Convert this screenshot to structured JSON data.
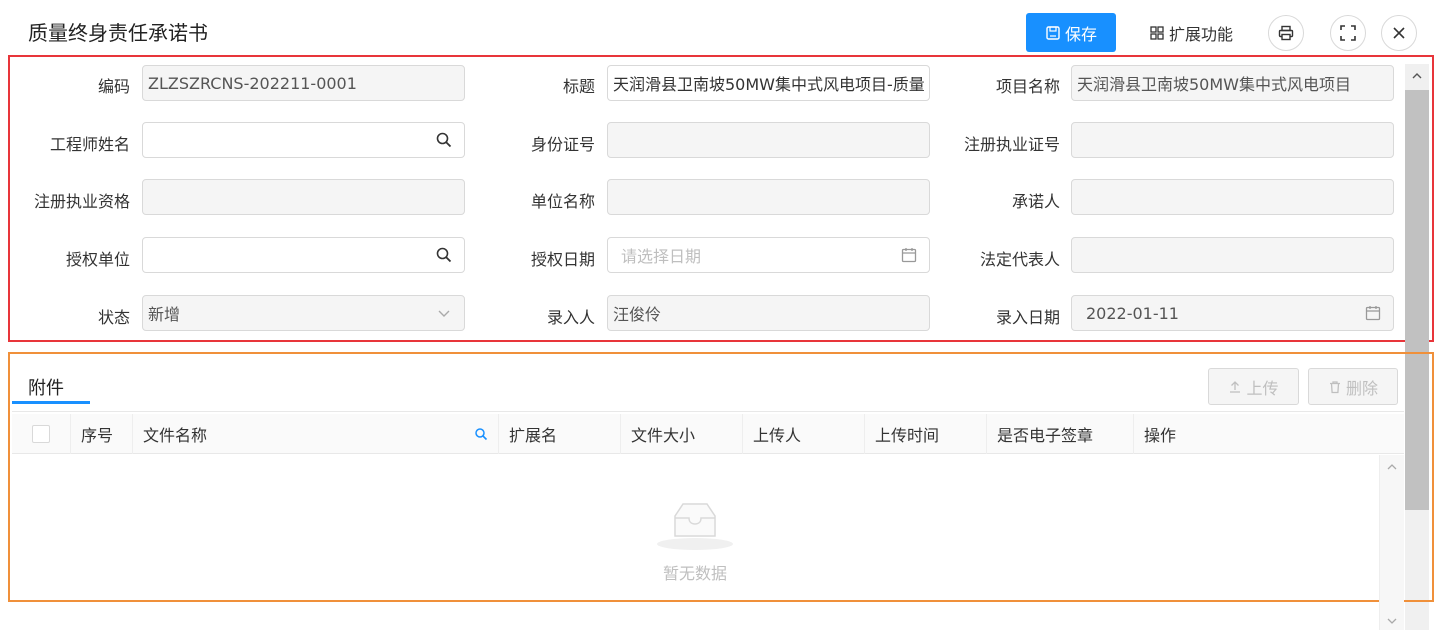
{
  "header": {
    "title": "质量终身责任承诺书",
    "save_label": "保存",
    "ext_label": "扩展功能"
  },
  "form": {
    "code_label": "编码",
    "code_value": "ZLZSZRCNS-202211-0001",
    "title_label": "标题",
    "title_value": "天润滑县卫南坡50MW集中式风电项目-质量",
    "project_label": "项目名称",
    "project_value": "天润滑县卫南坡50MW集中式风电项目",
    "engineer_label": "工程师姓名",
    "idcard_label": "身份证号",
    "reg_no_label": "注册执业证号",
    "reg_qual_label": "注册执业资格",
    "unit_label": "单位名称",
    "promisor_label": "承诺人",
    "auth_unit_label": "授权单位",
    "auth_date_label": "授权日期",
    "auth_date_placeholder": "请选择日期",
    "legal_rep_label": "法定代表人",
    "status_label": "状态",
    "status_value": "新增",
    "entry_user_label": "录入人",
    "entry_user_value": "汪俊伶",
    "entry_date_label": "录入日期",
    "entry_date_value": "2022-01-11"
  },
  "attachments": {
    "tab_label": "附件",
    "upload_label": "上传",
    "delete_label": "删除",
    "columns": [
      "序号",
      "文件名称",
      "扩展名",
      "文件大小",
      "上传人",
      "上传时间",
      "是否电子签章",
      "操作"
    ],
    "empty_text": "暂无数据"
  },
  "colors": {
    "primary": "#1890ff",
    "form_border": "#e8353a",
    "attach_border": "#f0903a"
  }
}
